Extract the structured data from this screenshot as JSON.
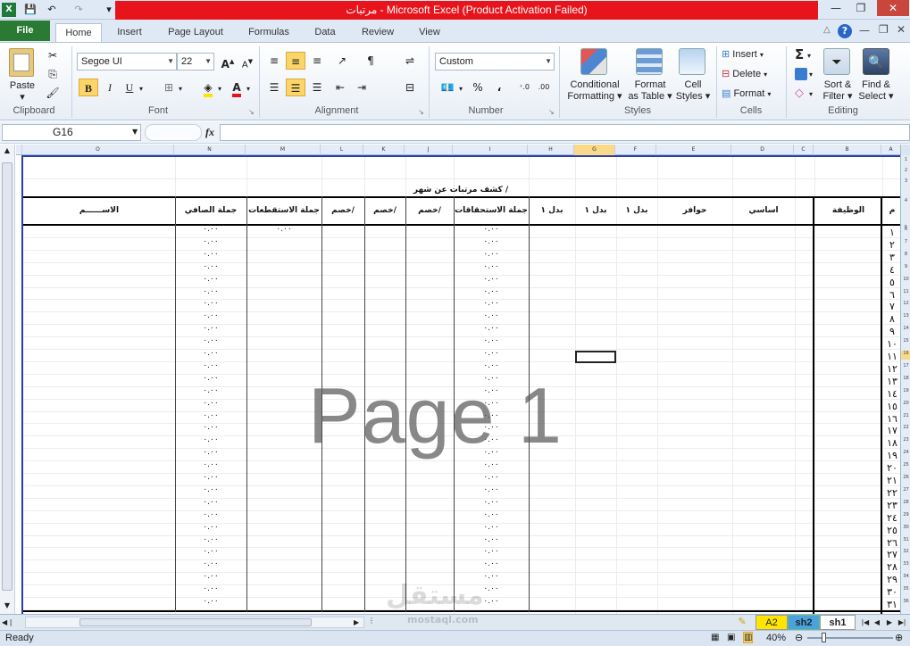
{
  "window": {
    "title": "مرتبات  -  Microsoft Excel (Product Activation Failed)",
    "controls": [
      "—",
      "❐",
      "✕"
    ]
  },
  "qat": {
    "save": "💾",
    "undo": "↶",
    "redo": "↷"
  },
  "tabs": {
    "file": "File",
    "home": "Home",
    "insert": "Insert",
    "page_layout": "Page Layout",
    "formulas": "Formulas",
    "data": "Data",
    "review": "Review",
    "view": "View"
  },
  "ribbon": {
    "clipboard": {
      "paste": "Paste",
      "label": "Clipboard"
    },
    "font": {
      "name": "Segoe UI",
      "size": "22",
      "label": "Font",
      "bold": "B",
      "italic": "I",
      "underline": "U",
      "grow": "A",
      "shrink": "A",
      "color_a": "A"
    },
    "alignment": {
      "label": "Alignment"
    },
    "number": {
      "format": "Custom",
      "label": "Number",
      "percent": "%",
      "comma": "،",
      "inc": "←.0 .00",
      "dec": ".00 →.0"
    },
    "styles": {
      "conditional": [
        "Conditional",
        "Formatting ▾"
      ],
      "format_table": [
        "Format",
        "as Table ▾"
      ],
      "cell_styles": [
        "Cell",
        "Styles ▾"
      ],
      "label": "Styles"
    },
    "cells": {
      "insert": "Insert",
      "delete": "Delete",
      "format": "Format",
      "label": "Cells"
    },
    "editing": {
      "sum": "Σ",
      "sort": [
        "Sort &",
        "Filter ▾"
      ],
      "find": [
        "Find &",
        "Select ▾"
      ],
      "label": "Editing"
    }
  },
  "formula_bar": {
    "name_box": "G16",
    "fx": "fx",
    "value": ""
  },
  "columns": [
    "O",
    "N",
    "M",
    "L",
    "K",
    "J",
    "I",
    "H",
    "G",
    "F",
    "E",
    "D",
    "C",
    "B",
    "A"
  ],
  "sheet": {
    "title": "كشف مرتبات عن شهر /",
    "headers": {
      "m": "م",
      "job": "الوظيفة",
      "basic": "اساسي",
      "incentives": "حوافز",
      "allow1": "بدل ١",
      "allow2": "بدل ١",
      "allow3": "بدل ١",
      "total_earn": "جملة الاستحقاقات",
      "ded1": "خصم/",
      "ded2": "خصم/",
      "ded3": "خصم/",
      "total_ded": "جملة الاستقطعات",
      "net": "جملة الصافي",
      "name": "الاســــــم"
    },
    "serials": [
      "١",
      "٢",
      "٣",
      "٤",
      "٥",
      "٦",
      "٧",
      "٨",
      "٩",
      "١٠",
      "١١",
      "١٢",
      "١٣",
      "١٤",
      "١٥",
      "١٦",
      "١٧",
      "١٨",
      "١٩",
      "٢٠",
      "٢١",
      "٢٢",
      "٢٣",
      "٢٤",
      "٢٥",
      "٢٦",
      "٢٧",
      "٢٨",
      "٢٩",
      "٣٠",
      "٣١"
    ],
    "zero_value": "٠.٠٠",
    "deduction_first_row": "٠.٠٠"
  },
  "row_numbers": [
    "1",
    "2",
    "3",
    "4",
    "5",
    "6",
    "7",
    "8",
    "9",
    "10",
    "11",
    "12",
    "13",
    "14",
    "15",
    "16",
    "17",
    "18",
    "19",
    "20",
    "21",
    "22",
    "23",
    "24",
    "25",
    "26",
    "27",
    "28",
    "29",
    "30",
    "31",
    "32",
    "33",
    "34",
    "35",
    "36"
  ],
  "watermark": "Page 1",
  "brand_watermark": {
    "arabic": "مستقل",
    "latin": "mostaql.com"
  },
  "sheet_tabs": [
    "A2",
    "sh2",
    "sh1"
  ],
  "status": {
    "ready": "Ready",
    "zoom": "40%"
  }
}
